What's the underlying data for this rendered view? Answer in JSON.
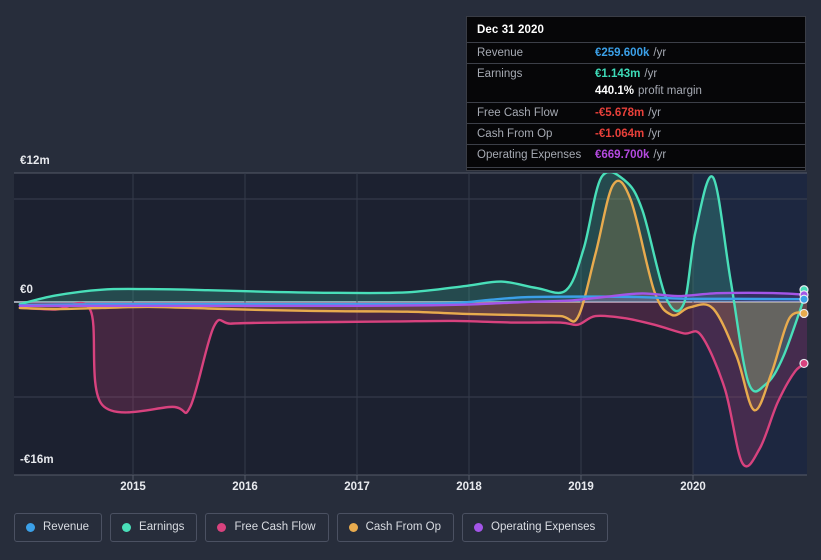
{
  "tooltip": {
    "title": "Dec 31 2020",
    "rows": [
      {
        "label": "Revenue",
        "value": "€259.600k",
        "unit": "/yr",
        "color": "#3ba0e8"
      },
      {
        "label": "Earnings",
        "value": "€1.143m",
        "unit": "/yr",
        "color": "#3ddbb8"
      },
      {
        "label": "",
        "value": "440.1%",
        "unit": "profit margin",
        "color": "#ffffff"
      },
      {
        "label": "Free Cash Flow",
        "value": "-€5.678m",
        "unit": "/yr",
        "color": "#e8403a"
      },
      {
        "label": "Cash From Op",
        "value": "-€1.064m",
        "unit": "/yr",
        "color": "#e8403a"
      },
      {
        "label": "Operating Expenses",
        "value": "€669.700k",
        "unit": "/yr",
        "color": "#b44ae0"
      }
    ]
  },
  "legend": {
    "items": [
      {
        "label": "Revenue",
        "color": "#3ba0e8"
      },
      {
        "label": "Earnings",
        "color": "#49dfb9"
      },
      {
        "label": "Free Cash Flow",
        "color": "#d8427e"
      },
      {
        "label": "Cash From Op",
        "color": "#e8ab4e"
      },
      {
        "label": "Operating Expenses",
        "color": "#a355e8"
      }
    ]
  },
  "chart_data": {
    "type": "area",
    "title": "",
    "xlabel": "",
    "ylabel": "",
    "ylim": [
      -16,
      12
    ],
    "y_ticks": [
      "-€16m",
      "€0",
      "€12m"
    ],
    "y_tick_values": [
      -16,
      0,
      12
    ],
    "x_ticks": [
      "2015",
      "2016",
      "2017",
      "2018",
      "2019",
      "2020"
    ],
    "x_tick_values": [
      2015,
      2016,
      2017,
      2018,
      2019,
      2020
    ],
    "x_range": [
      2014.25,
      2021.0
    ],
    "grid": true,
    "legend_position": "bottom",
    "units": "EUR millions",
    "forecast_region_start": 2020.0,
    "series": [
      {
        "name": "Revenue",
        "color": "#3ba0e8",
        "fill": "rgba(59,160,232,0.18)",
        "x": [
          2014.3,
          2014.6,
          2015.0,
          2015.5,
          2016.0,
          2016.5,
          2017.0,
          2017.5,
          2018.0,
          2018.3,
          2018.6,
          2019.0,
          2019.3,
          2019.6,
          2020.0,
          2020.3,
          2020.6,
          2021.0
        ],
        "values": [
          -0.3,
          -0.25,
          -0.2,
          -0.2,
          -0.2,
          -0.2,
          -0.2,
          -0.2,
          -0.1,
          0.2,
          0.45,
          0.5,
          0.5,
          0.45,
          0.3,
          0.3,
          0.28,
          0.26
        ]
      },
      {
        "name": "Earnings",
        "color": "#49dfb9",
        "fill": "rgba(73,223,185,0.22)",
        "x": [
          2014.3,
          2014.6,
          2015.0,
          2015.4,
          2015.9,
          2016.4,
          2017.0,
          2017.6,
          2018.1,
          2018.4,
          2018.7,
          2018.95,
          2019.1,
          2019.25,
          2019.45,
          2019.6,
          2019.8,
          2019.95,
          2020.05,
          2020.2,
          2020.35,
          2020.5,
          2020.65,
          2020.8,
          2021.0
        ],
        "values": [
          -0.2,
          0.6,
          1.15,
          1.2,
          1.1,
          0.95,
          0.85,
          0.9,
          1.5,
          1.9,
          1.3,
          1.1,
          5.0,
          11.6,
          11.3,
          8.5,
          0.4,
          -0.2,
          6.5,
          11.6,
          2.0,
          -7.4,
          -7.6,
          -5.0,
          1.14
        ]
      },
      {
        "name": "Free Cash Flow",
        "color": "#d8427e",
        "fill": "rgba(216,66,126,0.22)",
        "x": [
          2014.3,
          2014.6,
          2014.9,
          2015.0,
          2015.6,
          2015.75,
          2015.95,
          2016.1,
          2016.5,
          2017.0,
          2017.5,
          2018.0,
          2018.5,
          2018.9,
          2019.05,
          2019.2,
          2019.45,
          2019.7,
          2019.95,
          2020.1,
          2020.3,
          2020.45,
          2020.6,
          2020.75,
          2020.9,
          2021.0
        ],
        "values": [
          -0.55,
          -0.7,
          -0.75,
          -9.5,
          -9.7,
          -9.7,
          -2.3,
          -2.0,
          -1.9,
          -1.85,
          -1.8,
          -1.75,
          -1.9,
          -1.9,
          -2.1,
          -1.3,
          -1.5,
          -2.1,
          -2.9,
          -3.1,
          -8.0,
          -14.9,
          -13.5,
          -9.3,
          -6.4,
          -5.68
        ]
      },
      {
        "name": "Cash From Op",
        "color": "#e8ab4e",
        "fill": "rgba(232,171,78,0.20)",
        "x": [
          2014.3,
          2014.6,
          2015.0,
          2015.4,
          2015.9,
          2016.4,
          2017.0,
          2017.6,
          2018.1,
          2018.5,
          2018.9,
          2019.05,
          2019.2,
          2019.35,
          2019.5,
          2019.7,
          2019.85,
          2020.0,
          2020.2,
          2020.4,
          2020.55,
          2020.7,
          2020.85,
          2021.0
        ],
        "values": [
          -0.55,
          -0.65,
          -0.55,
          -0.45,
          -0.6,
          -0.75,
          -0.85,
          -0.9,
          -1.1,
          -1.2,
          -1.3,
          -1.4,
          4.5,
          10.9,
          9.5,
          1.0,
          -1.2,
          -0.5,
          -0.6,
          -5.0,
          -10.0,
          -6.5,
          -1.5,
          -1.06
        ]
      },
      {
        "name": "Operating Expenses",
        "color": "#a355e8",
        "fill": "rgba(163,85,232,0.18)",
        "x": [
          2014.3,
          2015.0,
          2015.6,
          2016.0,
          2016.6,
          2017.2,
          2017.8,
          2018.2,
          2018.6,
          2019.0,
          2019.3,
          2019.6,
          2019.9,
          2020.2,
          2020.5,
          2020.8,
          2021.0
        ],
        "values": [
          -0.35,
          -0.35,
          -0.35,
          -0.35,
          -0.35,
          -0.35,
          -0.3,
          -0.2,
          0.0,
          0.15,
          0.5,
          0.8,
          0.55,
          0.8,
          0.85,
          0.8,
          0.67
        ]
      }
    ],
    "end_markers": [
      {
        "name": "Earnings",
        "color": "#49dfb9",
        "value": 1.14
      },
      {
        "name": "Operating Expenses",
        "color": "#a355e8",
        "value": 0.67
      },
      {
        "name": "Revenue",
        "color": "#3ba0e8",
        "value": 0.26
      },
      {
        "name": "Cash From Op",
        "color": "#e8ab4e",
        "value": -1.06
      },
      {
        "name": "Free Cash Flow",
        "color": "#d8427e",
        "value": -5.68
      }
    ]
  }
}
